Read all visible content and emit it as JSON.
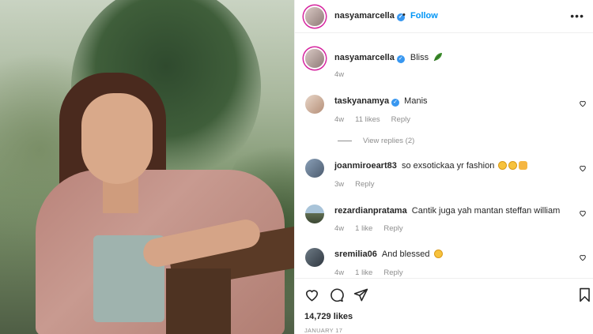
{
  "post": {
    "author": "nasyamarcella",
    "follow_label": "Follow",
    "dot": "•",
    "more": "•••",
    "caption": "Bliss",
    "caption_age": "4w",
    "likes": "14,729 likes",
    "date": "JANUARY 17"
  },
  "comments": [
    {
      "user": "taskyanamya",
      "text": "Manis",
      "age": "4w",
      "likes": "11 likes",
      "reply": "Reply",
      "view_replies": "View replies (2)"
    },
    {
      "user": "joanmiroeart83",
      "text": "so exsotickaa yr fashion",
      "age": "3w",
      "reply": "Reply"
    },
    {
      "user": "rezardianpratama",
      "text": "Cantik juga yah mantan steffan william",
      "age": "4w",
      "likes": "1 like",
      "reply": "Reply"
    },
    {
      "user": "sremilia06",
      "text": "And blessed",
      "age": "4w",
      "likes": "1 like",
      "reply": "Reply"
    }
  ],
  "icons": {
    "verified": "verified-badge-icon",
    "leaf": "leaf-emoji-icon",
    "heart": "heart-icon",
    "comment": "comment-icon",
    "share": "share-icon",
    "bookmark": "bookmark-icon"
  },
  "colors": {
    "link": "#0095f6",
    "verified": "#3897f0",
    "muted": "#8e8e8e",
    "story_ring": "#d6249f"
  }
}
